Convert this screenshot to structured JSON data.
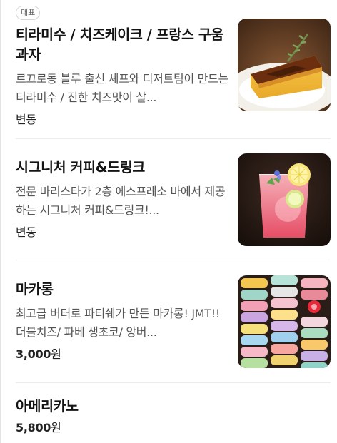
{
  "menu": {
    "items": [
      {
        "badge": "대표",
        "name": "티라미수 / 치즈케이크 / 프랑스 구움과자",
        "description": "르끄로동 블루 출신 셰프와 디저트팀이 만드는 티라미수 / 진한 치즈맛이 살...",
        "price": "변동",
        "image_icon": "cheesecake-photo"
      },
      {
        "name": "시그니처 커피&드링크",
        "description": "전문 바리스타가 2층 에스프레소 바에서 제공하는 시그니처 커피&드링크!...",
        "price": "변동",
        "image_icon": "pink-lemonade-photo"
      },
      {
        "name": "마카롱",
        "description": "최고급 버터로 파티쉐가 만든 마카롱! JMT!! 더블치즈/ 파베 생초코/ 앙버...",
        "price_amount": "3,000",
        "price_unit": "원",
        "image_icon": "macaron-stack-photo"
      },
      {
        "name": "아메리카노",
        "price_amount": "5,800",
        "price_unit": "원"
      }
    ]
  }
}
